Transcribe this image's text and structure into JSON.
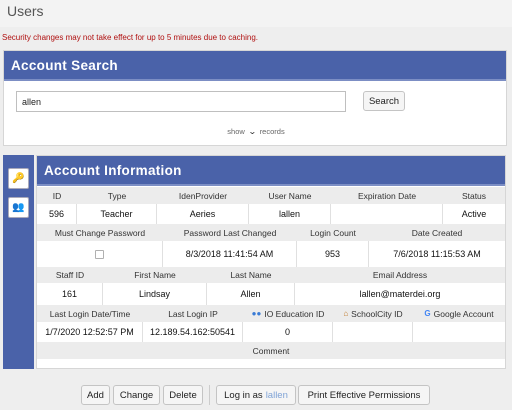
{
  "page": {
    "title": "Users",
    "warning": "Security changes may not take effect for up to 5 minutes due to caching."
  },
  "search": {
    "panel_title": "Account Search",
    "query": "allen",
    "button_label": "Search",
    "show_label": "show",
    "records_label": "records"
  },
  "side_tools": {
    "key_icon": "key-icon",
    "users_icon": "users-icon"
  },
  "account": {
    "panel_title": "Account Information",
    "row1_headers": [
      "ID",
      "Type",
      "IdenProvider",
      "User Name",
      "Expiration Date",
      "Status"
    ],
    "row1_values": [
      "596",
      "Teacher",
      "Aeries",
      "lallen",
      "",
      "Active"
    ],
    "row2_headers": [
      "Must Change Password",
      "Password Last Changed",
      "Login Count",
      "Date Created"
    ],
    "row2_values": [
      "",
      "8/3/2018 11:41:54 AM",
      "953",
      "7/6/2018 11:15:53 AM"
    ],
    "row3_headers": [
      "Staff ID",
      "First Name",
      "Last Name",
      "Email Address"
    ],
    "row3_values": [
      "161",
      "Lindsay",
      "Allen",
      "lallen@materdei.org"
    ],
    "row4_headers": [
      "Last Login Date/Time",
      "Last Login IP",
      "IO Education ID",
      "SchoolCity ID",
      "Google Account"
    ],
    "row4_values": [
      "1/7/2020 12:52:57 PM",
      "12.189.54.162:50541",
      "0",
      "",
      ""
    ],
    "comment_header": "Comment",
    "comment_value": ""
  },
  "actions": {
    "add": "Add",
    "change": "Change",
    "delete": "Delete",
    "login_as": "Log in as",
    "login_user": "lallen",
    "print_permissions": "Print Effective Permissions"
  },
  "colors": {
    "panel_header": "#4a62a9",
    "warning_text": "#b01010",
    "login_user_text": "#7fa3d6"
  }
}
